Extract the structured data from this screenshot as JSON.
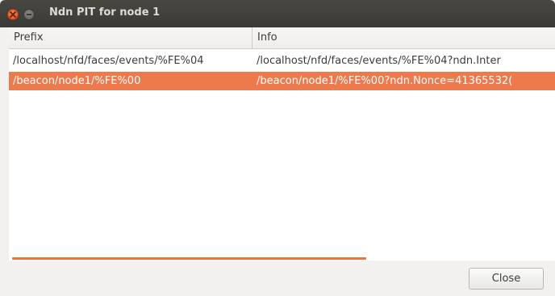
{
  "window": {
    "title": "Ndn PIT for node 1"
  },
  "table": {
    "columns": [
      "Prefix",
      "Info"
    ],
    "rows": [
      {
        "prefix": "/localhost/nfd/faces/events/%FE%04",
        "info": "/localhost/nfd/faces/events/%FE%04?ndn.Inter",
        "selected": false
      },
      {
        "prefix": "/beacon/node1/%FE%00",
        "info": "/beacon/node1/%FE%00?ndn.Nonce=41365532(",
        "selected": true
      }
    ]
  },
  "footer": {
    "close_label": "Close"
  },
  "colors": {
    "selection": "#ec7a4c",
    "titlebar": "#3c3b37",
    "close_button_accent": "#df4a16"
  }
}
